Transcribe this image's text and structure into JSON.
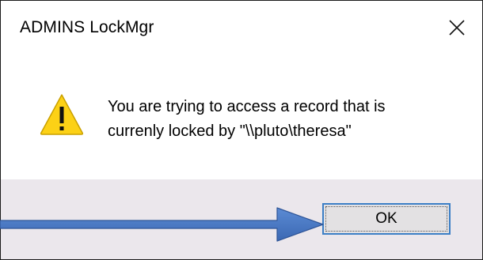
{
  "window": {
    "title": "ADMINS LockMgr"
  },
  "dialog": {
    "message_line1": "You are trying to access a record that is",
    "message_line2": "currenly locked by \"\\\\pluto\\theresa\"",
    "icon": "warning-icon"
  },
  "buttons": {
    "ok_label": "OK",
    "close_icon": "close-icon"
  },
  "colors": {
    "footer_bg": "#ebe7ec",
    "button_border": "#3c7fc6",
    "arrow": "#4472c4",
    "warning_fill": "#fcd116"
  }
}
